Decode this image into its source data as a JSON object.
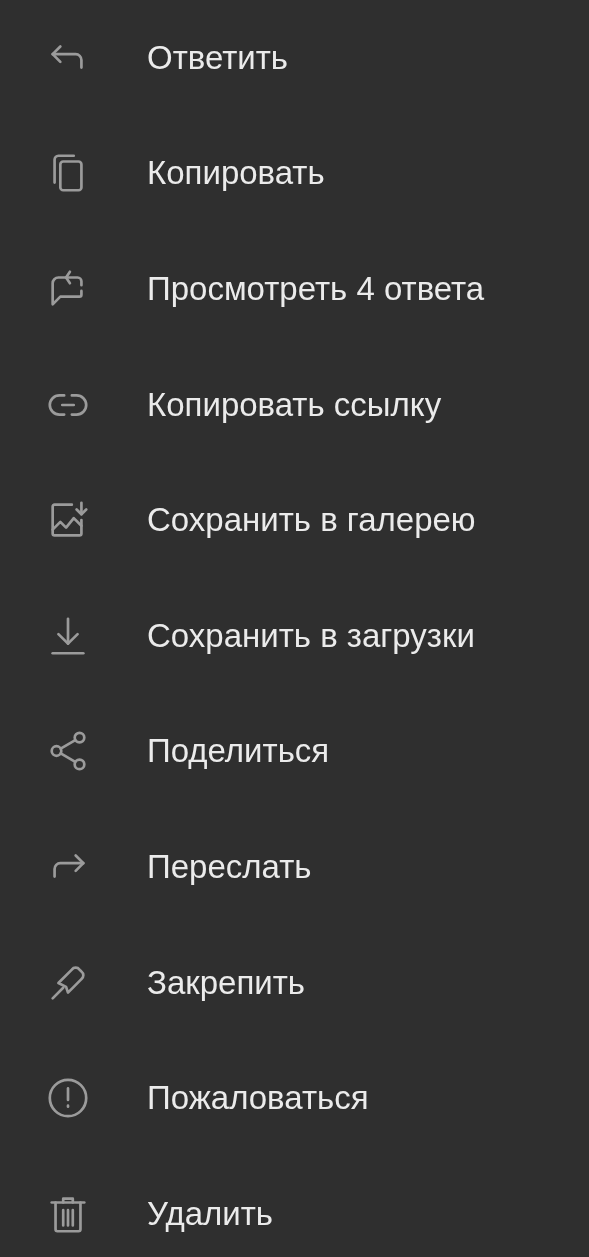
{
  "menu": {
    "items": [
      {
        "kind": "reply",
        "label": "Ответить"
      },
      {
        "kind": "copy",
        "label": "Копировать"
      },
      {
        "kind": "thread",
        "label": "Просмотреть 4 ответа"
      },
      {
        "kind": "link",
        "label": "Копировать ссылку"
      },
      {
        "kind": "gallery",
        "label": "Сохранить в галерею"
      },
      {
        "kind": "download",
        "label": "Сохранить в загрузки"
      },
      {
        "kind": "share",
        "label": "Поделиться"
      },
      {
        "kind": "forward",
        "label": "Переслать"
      },
      {
        "kind": "pin",
        "label": "Закрепить"
      },
      {
        "kind": "report",
        "label": "Пожаловаться"
      },
      {
        "kind": "delete",
        "label": "Удалить"
      }
    ]
  }
}
